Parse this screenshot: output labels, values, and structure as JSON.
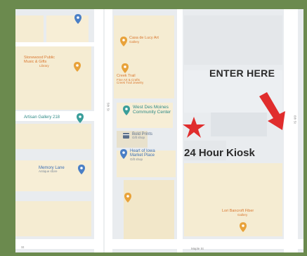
{
  "callouts": {
    "enter_here": "ENTER HERE",
    "kiosk": "24 Hour Kiosk"
  },
  "pois": {
    "casa": {
      "name": "Casa de Lucy Art",
      "sub": "Gallery"
    },
    "library": {
      "name": "Stonewood Public",
      "name2": "Music & Gifts",
      "sub": "Library"
    },
    "creek": {
      "name": "Creek Trail",
      "name2": "Fine Art & Crafts",
      "sub": "Creek Trail Jewelry"
    },
    "artisan": {
      "name": "Artisan Gallery 218"
    },
    "wdm": {
      "name": "West Des Moines",
      "name2": "Community Center"
    },
    "bold": {
      "name": "Bold Prints",
      "sub": "Gift shop"
    },
    "heart": {
      "name": "Heart of Iowa",
      "name2": "Market Place",
      "sub": "Gift shop"
    },
    "memory": {
      "name": "Memory Lane",
      "sub": "Antique store"
    },
    "orange_bottom": {
      "name": "Lori Bancroft Fiber",
      "sub": "Gallery"
    }
  },
  "streets": {
    "maple": "Maple St",
    "col_left": "5th St",
    "col_right": "6th St",
    "sw": "St"
  },
  "colors": {
    "border": "#6b8a4e",
    "map_bg": "#e9ecef",
    "block": "#f5ecd2",
    "block_grey": "#dfe3e7",
    "road": "#ffffff",
    "poi_orange": "#d9772f",
    "poi_blue": "#3c6fb4",
    "star": "#e02d2d",
    "arrow": "#e02d2d"
  },
  "icons": [
    "pin-orange-icon",
    "pin-blue-icon",
    "star-icon",
    "arrow-icon",
    "gift-icon"
  ]
}
